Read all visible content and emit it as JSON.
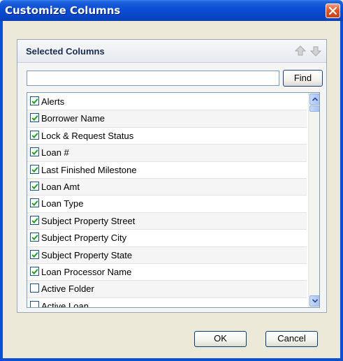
{
  "window": {
    "title": "Customize Columns",
    "close_icon": "close-icon"
  },
  "panel": {
    "title": "Selected Columns",
    "move_up_icon": "arrow-up-icon",
    "move_down_icon": "arrow-down-icon"
  },
  "search": {
    "value": "",
    "placeholder": "",
    "find_label": "Find"
  },
  "columns": [
    {
      "label": "Alerts",
      "checked": true
    },
    {
      "label": "Borrower Name",
      "checked": true
    },
    {
      "label": "Lock & Request Status",
      "checked": true
    },
    {
      "label": "Loan #",
      "checked": true
    },
    {
      "label": "Last Finished Milestone",
      "checked": true
    },
    {
      "label": "Loan Amt",
      "checked": true
    },
    {
      "label": "Loan Type",
      "checked": true
    },
    {
      "label": "Subject Property Street",
      "checked": true
    },
    {
      "label": "Subject Property City",
      "checked": true
    },
    {
      "label": "Subject Property State",
      "checked": true
    },
    {
      "label": "Loan Processor Name",
      "checked": true
    },
    {
      "label": "Active Folder",
      "checked": false
    },
    {
      "label": "Active Loan",
      "checked": false
    }
  ],
  "buttons": {
    "ok_label": "OK",
    "cancel_label": "Cancel"
  },
  "colors": {
    "titlebar": "#0b4fd4",
    "dialog_bg": "#ece9d8",
    "checkmark": "#21a121"
  }
}
